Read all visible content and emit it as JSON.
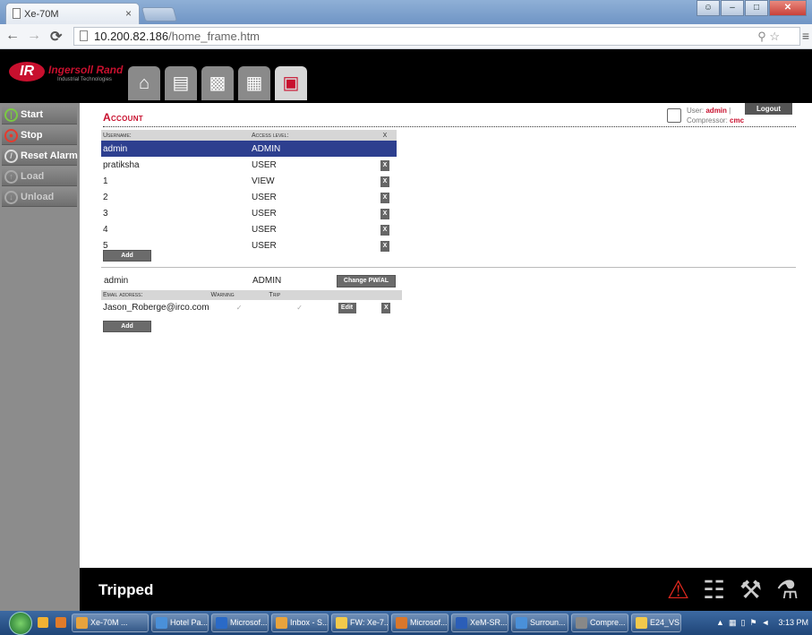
{
  "browser": {
    "tab_title": "Xe-70M",
    "tab_close": "×",
    "url_host": "10.200.82.186",
    "url_path": "/home_frame.htm"
  },
  "app": {
    "brand": "Ingersoll Rand",
    "brand_logo": "IR",
    "brand_sub": "Industrial Technologies",
    "nav_tabs": [
      "home-icon",
      "report-icon",
      "settings-icon",
      "status-icon",
      "account-icon"
    ],
    "accent_color": "#c8102e"
  },
  "sidebar": {
    "items": [
      {
        "label": "Start",
        "icon": "power-icon",
        "color": "#7ac943"
      },
      {
        "label": "Stop",
        "icon": "stop-icon",
        "color": "#e63a2e"
      },
      {
        "label": "Reset Alarm",
        "icon": "reset-icon",
        "color": "#dddddd"
      },
      {
        "label": "Load",
        "icon": "load-icon",
        "color": "#aaaaaa"
      },
      {
        "label": "Unload",
        "icon": "unload-icon",
        "color": "#aaaaaa"
      }
    ]
  },
  "account": {
    "title": "Account",
    "user_label": "User:",
    "user_value": "admin",
    "sep": "|",
    "compressor_label": "Compressor:",
    "compressor_value": "cmc",
    "logout_label": "Logout",
    "users_table": {
      "headers": [
        "Username:",
        "Access level:",
        "X"
      ],
      "rows": [
        {
          "username": "admin",
          "access": "ADMIN",
          "selected": true
        },
        {
          "username": "pratiksha",
          "access": "USER"
        },
        {
          "username": "1",
          "access": "VIEW"
        },
        {
          "username": "2",
          "access": "USER"
        },
        {
          "username": "3",
          "access": "USER"
        },
        {
          "username": "4",
          "access": "USER"
        },
        {
          "username": "5",
          "access": "USER"
        }
      ],
      "delete_label": "X"
    },
    "add_label": "Add",
    "selected_user": {
      "username": "admin",
      "access": "ADMIN",
      "change_pw_label": "Change PW/AL"
    },
    "email_table": {
      "headers": [
        "Email address:",
        "Warning",
        "Trip"
      ],
      "rows": [
        {
          "email": "Jason_Roberge@irco.com",
          "warning": "✓",
          "trip": "✓"
        }
      ],
      "edit_label": "Edit",
      "delete_label": "X"
    },
    "add_email_label": "Add"
  },
  "status": {
    "text": "Tripped",
    "icons": [
      "alarm-icon",
      "network-icon",
      "service-icon",
      "maintenance-icon"
    ]
  },
  "taskbar": {
    "items": [
      {
        "label": "Xe-70M ...",
        "color": "#e8a33d"
      },
      {
        "label": "Hotel Pa...",
        "color": "#4a90d9"
      },
      {
        "label": "Microsof...",
        "color": "#2a6ac7"
      },
      {
        "label": "Inbox - S...",
        "color": "#e8a33d"
      },
      {
        "label": "FW: Xe-7...",
        "color": "#f2c94c"
      },
      {
        "label": "Microsof...",
        "color": "#d9772b"
      },
      {
        "label": "XeM-SR...",
        "color": "#2b5eb8"
      },
      {
        "label": "Surroun...",
        "color": "#4a90d9"
      },
      {
        "label": "Compre...",
        "color": "#888888"
      },
      {
        "label": "E24_VS",
        "color": "#f2c94c"
      }
    ],
    "clock": "3:13 PM"
  }
}
